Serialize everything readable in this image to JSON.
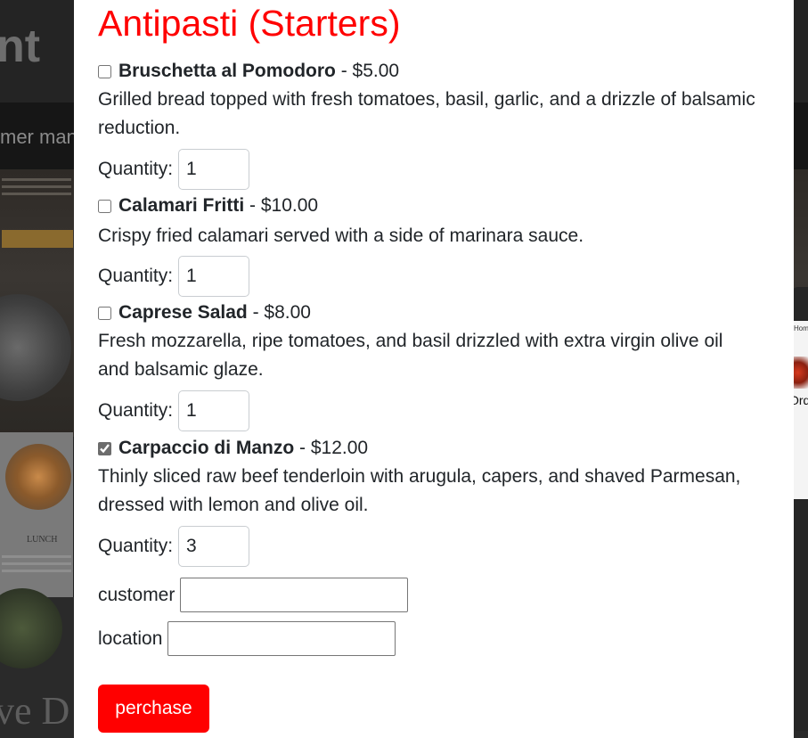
{
  "background": {
    "logo_fragment": "nt",
    "nav_fragment": "mer mana",
    "card_title": "LUNCH",
    "banner_fragment": "ve D",
    "preview": {
      "home_fragment": "Hom",
      "heading_fragment": "Ord"
    }
  },
  "menu": {
    "section_title": "Antipasti (Starters)",
    "quantity_label": "Quantity:",
    "items": [
      {
        "name": "Bruschetta al Pomodoro",
        "price": " - $5.00",
        "checked": false,
        "description": "Grilled bread topped with fresh tomatoes, basil, garlic, and a drizzle of balsamic reduction.",
        "quantity": "1"
      },
      {
        "name": "Calamari Fritti",
        "price": " - $10.00",
        "checked": false,
        "description": "Crispy fried calamari served with a side of marinara sauce.",
        "quantity": "1"
      },
      {
        "name": "Caprese Salad",
        "price": " - $8.00",
        "checked": false,
        "description": "Fresh mozzarella, ripe tomatoes, and basil drizzled with extra virgin olive oil and balsamic glaze.",
        "quantity": "1"
      },
      {
        "name": "Carpaccio di Manzo",
        "price": " - $12.00",
        "checked": true,
        "description": "Thinly sliced raw beef tenderloin with arugula, capers, and shaved Parmesan, dressed with lemon and olive oil.",
        "quantity": "3"
      }
    ]
  },
  "form": {
    "customer_label": "customer",
    "customer_value": "",
    "location_label": "location",
    "location_value": "",
    "submit_label": "perchase"
  },
  "colors": {
    "title": "#ff0000",
    "button_bg": "#ff0000",
    "button_text": "#ffffff",
    "text": "#212529"
  }
}
